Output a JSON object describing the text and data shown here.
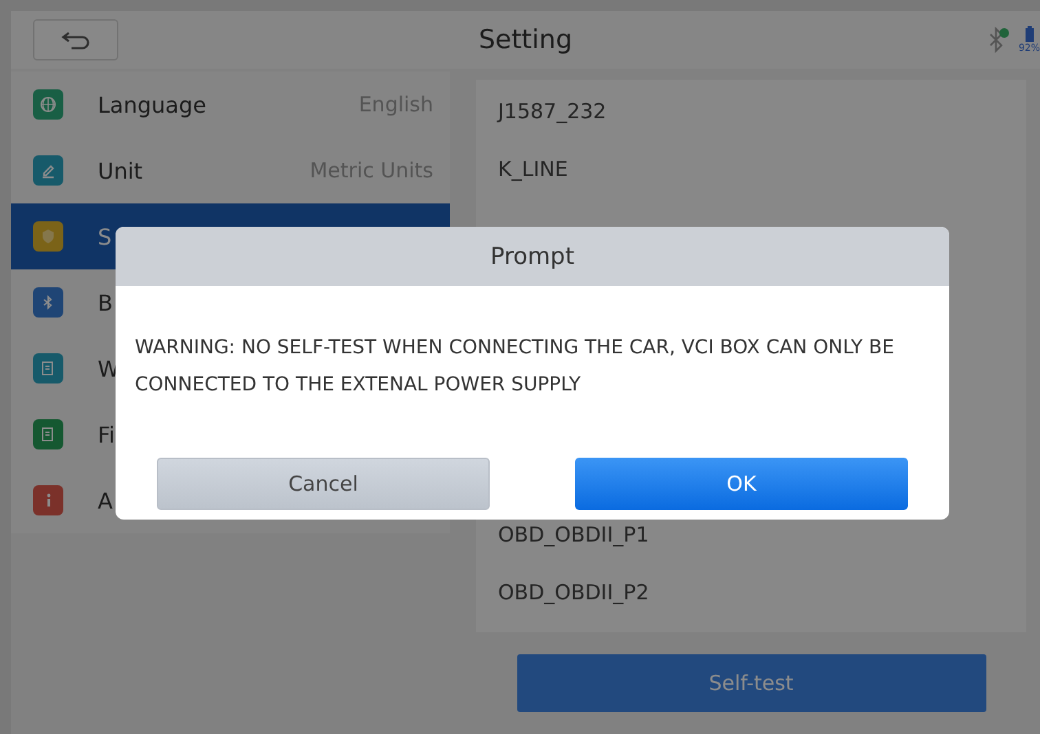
{
  "top_bar": {
    "title": "Setting",
    "battery": "92%"
  },
  "sidebar": {
    "items": [
      {
        "label": "Language",
        "value": "English",
        "selected": false
      },
      {
        "label": "Unit",
        "value": "Metric Units",
        "selected": false
      },
      {
        "label": "S",
        "selected": true
      },
      {
        "label": "B",
        "selected": false
      },
      {
        "label": "W",
        "selected": false
      },
      {
        "label": "Fi",
        "selected": false
      },
      {
        "label": "A",
        "selected": false
      }
    ]
  },
  "protocols": [
    "J1587_232",
    "K_LINE",
    "OBD_OBDII_P1",
    "OBD_OBDII_P2"
  ],
  "self_test_button": "Self-test",
  "dialog": {
    "title": "Prompt",
    "message": "WARNING: NO SELF-TEST WHEN CONNECTING THE CAR, VCI BOX CAN ONLY BE CONNECTED TO THE EXTENAL POWER SUPPLY",
    "buttons": [
      {
        "label": "Cancel",
        "kind": "secondary"
      },
      {
        "label": "OK",
        "kind": "primary"
      }
    ]
  }
}
